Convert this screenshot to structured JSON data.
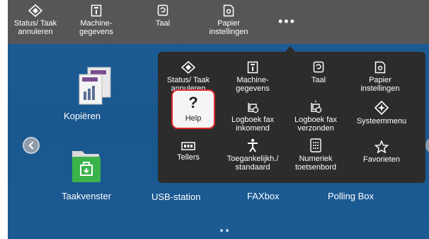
{
  "topbar": {
    "items": [
      {
        "line1": "Status/ Taak",
        "line2": "annuleren",
        "icon": "status-diamond-icon"
      },
      {
        "line1": "Machine-",
        "line2": "gegevens",
        "icon": "machine-info-icon"
      },
      {
        "line1": "Taal",
        "line2": "",
        "icon": "language-icon"
      },
      {
        "line1": "Papier",
        "line2": "instellingen",
        "icon": "paper-settings-icon"
      }
    ],
    "more": "•••"
  },
  "home": {
    "tiles": [
      {
        "label": "Kopiëren",
        "icon": "copy-icon"
      },
      {
        "label": "Taakvenster",
        "icon": "job-box-icon"
      },
      {
        "label": "USB-station",
        "icon": "usb-icon"
      },
      {
        "label": "FAXbox",
        "icon": "fax-box-icon"
      },
      {
        "label": "Polling Box",
        "icon": "polling-box-icon"
      }
    ]
  },
  "menu": {
    "items": [
      {
        "line1": "Status/ Taak",
        "line2": "annuleren",
        "icon": "status-diamond-icon"
      },
      {
        "line1": "Machine-",
        "line2": "gegevens",
        "icon": "machine-info-icon"
      },
      {
        "line1": "Taal",
        "line2": "",
        "icon": "language-icon"
      },
      {
        "line1": "Papier",
        "line2": "instellingen",
        "icon": "paper-settings-icon"
      },
      {
        "line1": "Help",
        "line2": "",
        "icon": "question-mark-icon"
      },
      {
        "line1": "Logboek fax",
        "line2": "inkomend",
        "icon": "fax-log-in-icon"
      },
      {
        "line1": "Logboek fax",
        "line2": "verzonden",
        "icon": "fax-log-out-icon"
      },
      {
        "line1": "Systeemmenu",
        "line2": "",
        "icon": "system-menu-icon"
      },
      {
        "line1": "Tellers",
        "line2": "",
        "icon": "counter-icon"
      },
      {
        "line1": "Toegankelijkh./",
        "line2": "standaard",
        "icon": "accessibility-icon"
      },
      {
        "line1": "Numeriek",
        "line2": "toetsenbord",
        "icon": "keypad-icon"
      },
      {
        "line1": "Favorieten",
        "line2": "",
        "icon": "star-icon"
      }
    ],
    "help_symbol": "?"
  },
  "colors": {
    "topbar": "#565656",
    "background": "#1b5a93",
    "popup": "#2c2c2c",
    "highlight": "#e0262c",
    "job_box_green": "#3bb34a"
  }
}
